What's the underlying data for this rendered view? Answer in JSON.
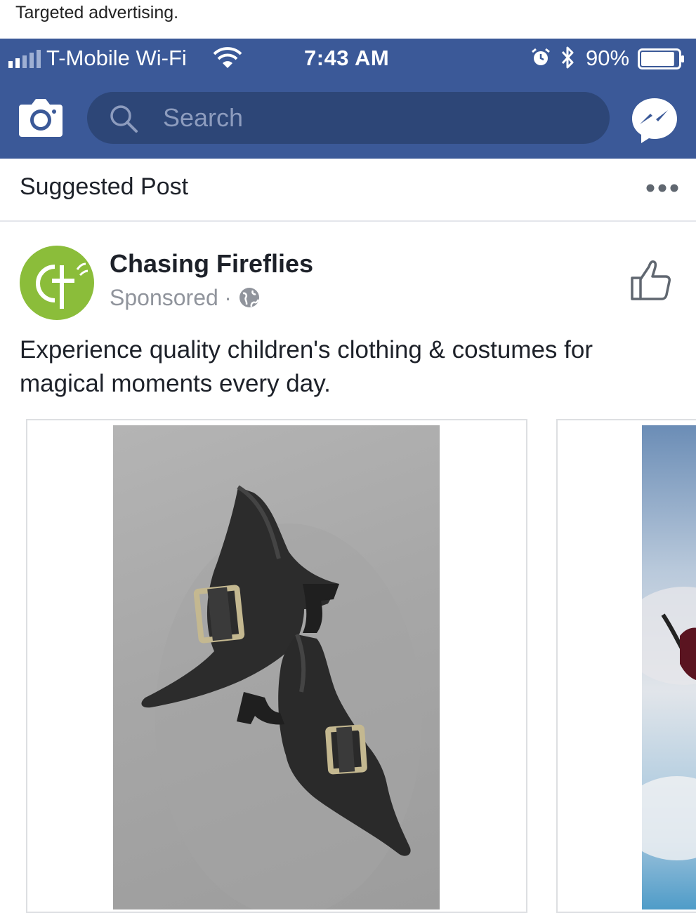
{
  "caption": "Targeted advertising.",
  "status_bar": {
    "carrier": "T-Mobile Wi-Fi",
    "time": "7:43 AM",
    "battery_percent": "90%",
    "battery_level": 0.9,
    "icons": [
      "signal-icon",
      "wifi-icon",
      "alarm-icon",
      "bluetooth-icon",
      "battery-icon"
    ]
  },
  "nav": {
    "search_placeholder": "Search",
    "icons": [
      "camera-icon",
      "search-icon",
      "messenger-icon"
    ]
  },
  "colors": {
    "header_blue": "#3b5998",
    "search_pill": "#2d4677",
    "brand_green": "#8bbd3a"
  },
  "suggested": {
    "label": "Suggested Post",
    "more_icon": "more-dots-icon"
  },
  "post": {
    "page_name": "Chasing Fireflies",
    "sponsored": "Sponsored",
    "separator": "·",
    "privacy_icon": "globe-icon",
    "like_icon": "thumbs-up-icon",
    "text": "Experience quality children's clothing & costumes for magical moments every day."
  },
  "carousel": {
    "cards": [
      {
        "image": "black witch boots with buckles"
      },
      {
        "image": "partially visible costume photo"
      }
    ]
  }
}
